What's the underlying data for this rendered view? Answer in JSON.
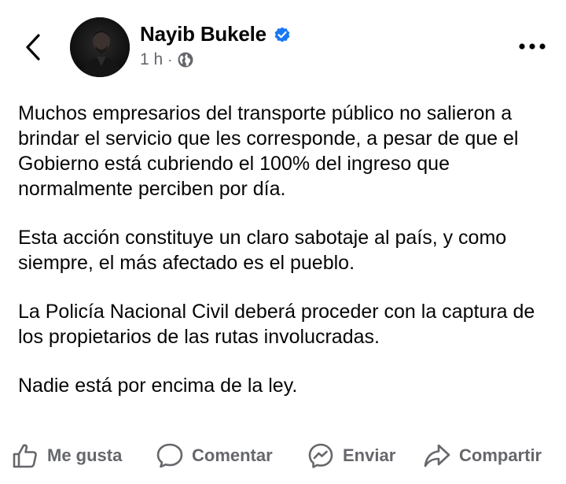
{
  "post": {
    "author_name": "Nayib Bukele",
    "verified": true,
    "time": "1 h",
    "separator": "·",
    "audience_icon": "globe-icon",
    "paragraphs": [
      "Muchos empresarios del transporte público no salieron a brindar el servicio que les corresponde, a pesar de que el Gobierno está cubriendo el 100% del ingreso que normalmente perciben por día.",
      "Esta acción constituye un claro sabotaje al país, y como siempre, el más afectado es el pueblo.",
      "La Policía Nacional Civil deberá proceder con la captura de los propietarios de las rutas involucradas.",
      "Nadie está por encima de la ley."
    ]
  },
  "header": {
    "back_icon": "chevron-left-icon",
    "more_icon": "more-horizontal-icon"
  },
  "actions": {
    "like_label": "Me gusta",
    "comment_label": "Comentar",
    "send_label": "Enviar",
    "share_label": "Compartir"
  },
  "colors": {
    "text": "#050505",
    "secondary": "#65676b",
    "verified": "#1877f2"
  }
}
